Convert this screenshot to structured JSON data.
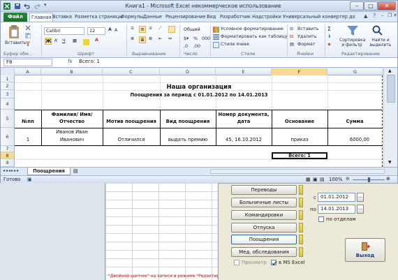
{
  "window": {
    "title": "Книга1 - Microsoft Excel некоммерческое использование"
  },
  "ribbon_tabs": [
    "Файл",
    "Главная",
    "Вставка",
    "Разметка страницы",
    "Формулы",
    "Данные",
    "Рецензирование",
    "Вид",
    "Разработчик",
    "Надстройки",
    "Универсальный конвертер до"
  ],
  "ribbon": {
    "paste_label": "Вставить",
    "font_name": "Calibri",
    "font_size": "12",
    "number_format": "Общий",
    "cond_format": "Условное форматирование",
    "format_table": "Форматировать как таблицу",
    "cell_styles": "Стили ячеек",
    "insert": "Вставить",
    "delete": "Удалить",
    "format": "Формат",
    "sort_filter": "Сортировка и фильтр",
    "find_select": "Найти и выделить",
    "groups": [
      "Буфер обм...",
      "Шрифт",
      "Выравнивание",
      "Число",
      "Стили",
      "Ячейки",
      "Редактирование"
    ]
  },
  "formula_bar": {
    "name_box": "F8",
    "fx": "fx",
    "content": "Всего:  1"
  },
  "grid": {
    "columns": [
      "A",
      "B",
      "C",
      "D",
      "E",
      "F",
      "G"
    ],
    "rows": [
      "1",
      "2",
      "3",
      "4",
      "5",
      "6",
      "7",
      "8",
      "9",
      "10"
    ],
    "org_title": "Наша организация",
    "report_title": "Поощрения за период с 01.01.2012 по 14.01.2013",
    "headers": {
      "num": "№пп",
      "fio": "Фамилия/ Имя/ Отчество",
      "motive": "Мотив поощрения",
      "type": "Вид поощрения",
      "doc": "Номер документа, дата",
      "basis": "Основание",
      "sum": "Сумма"
    },
    "row": {
      "num": "1",
      "fio_1": "Иванов Иван",
      "fio_2": "Иванович",
      "motive": "Отличился",
      "type": "выдать премию",
      "doc": "45, 16.10.2012",
      "basis": "приказ",
      "sum": "6000,00"
    },
    "total": "Всего:    1"
  },
  "sheet_tab": "Поощрения",
  "status": {
    "ready": "Готово",
    "zoom": "100%"
  },
  "panel": {
    "buttons": [
      "Переводы",
      "Больничные листы",
      "Командировки",
      "Отпуска",
      "Поощрения",
      "Мед. обследования"
    ],
    "selected": "Поощрения",
    "from_label": "с",
    "from_date": "01.01.2012",
    "to_label": "по",
    "to_date": "14.01.2013",
    "by_dept": "по отделам",
    "preview": "Просмотр",
    "in_excel": "в MS Excel",
    "exit": "Выход"
  },
  "bg_note": "\"Двойной щелчок\" на записи в режиме \"Редактировать\""
}
